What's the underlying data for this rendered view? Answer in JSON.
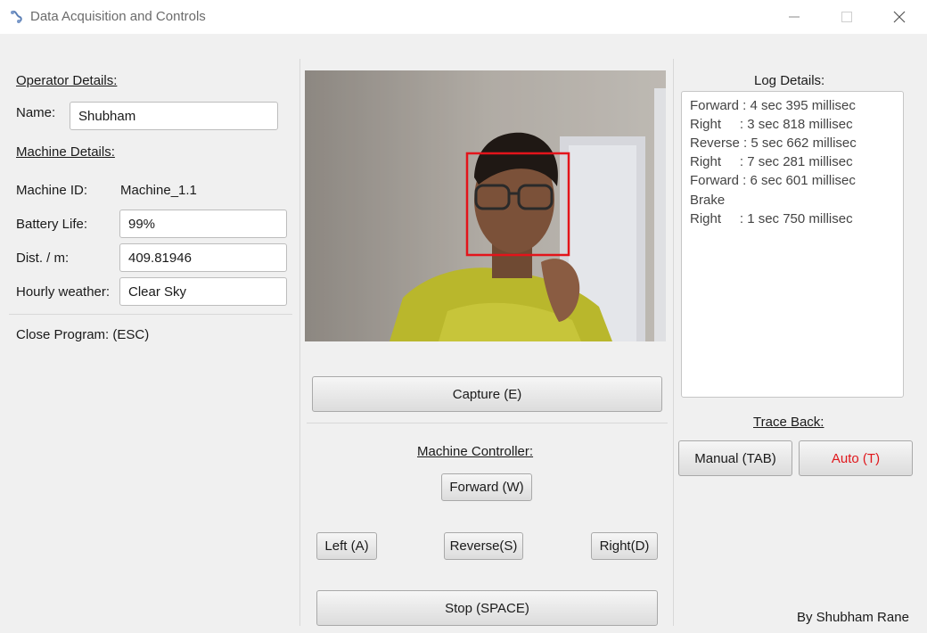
{
  "window": {
    "title": "Data Acquisition and Controls",
    "controls": {
      "minimize": "─",
      "maximize": "☐",
      "close": "✕"
    }
  },
  "left": {
    "operator_heading": "Operator Details:",
    "name_label": "Name:",
    "name_value": "Shubham",
    "machine_heading": "Machine Details:",
    "machine_id_label": "Machine ID:",
    "machine_id_value": "Machine_1.1",
    "battery_label": "Battery Life:",
    "battery_value": "99%",
    "dist_label": "Dist. / m:",
    "dist_value": "409.81946",
    "weather_label": "Hourly weather:",
    "weather_value": "Clear Sky",
    "close_label": "Close Program: (ESC)"
  },
  "center": {
    "capture_label": "Capture (E)",
    "controller_heading": "Machine Controller:",
    "forward_label": "Forward (W)",
    "left_label": "Left (A)",
    "reverse_label": "Reverse(S)",
    "right_label": "Right(D)",
    "stop_label": "Stop (SPACE)"
  },
  "right": {
    "log_heading": "Log Details:",
    "log_lines": [
      "Forward : 4 sec 395 millisec",
      "Right     : 3 sec 818 millisec",
      "Reverse : 5 sec 662 millisec",
      "Right     : 7 sec 281 millisec",
      "Forward : 6 sec 601 millisec",
      "Brake",
      "Right     : 1 sec 750 millisec"
    ],
    "trace_heading": "Trace Back:",
    "manual_label": "Manual (TAB)",
    "auto_label": "Auto (T)",
    "credit": "By Shubham Rane"
  },
  "colors": {
    "auto_text": "#e0161b",
    "face_box": "#e3141b"
  }
}
